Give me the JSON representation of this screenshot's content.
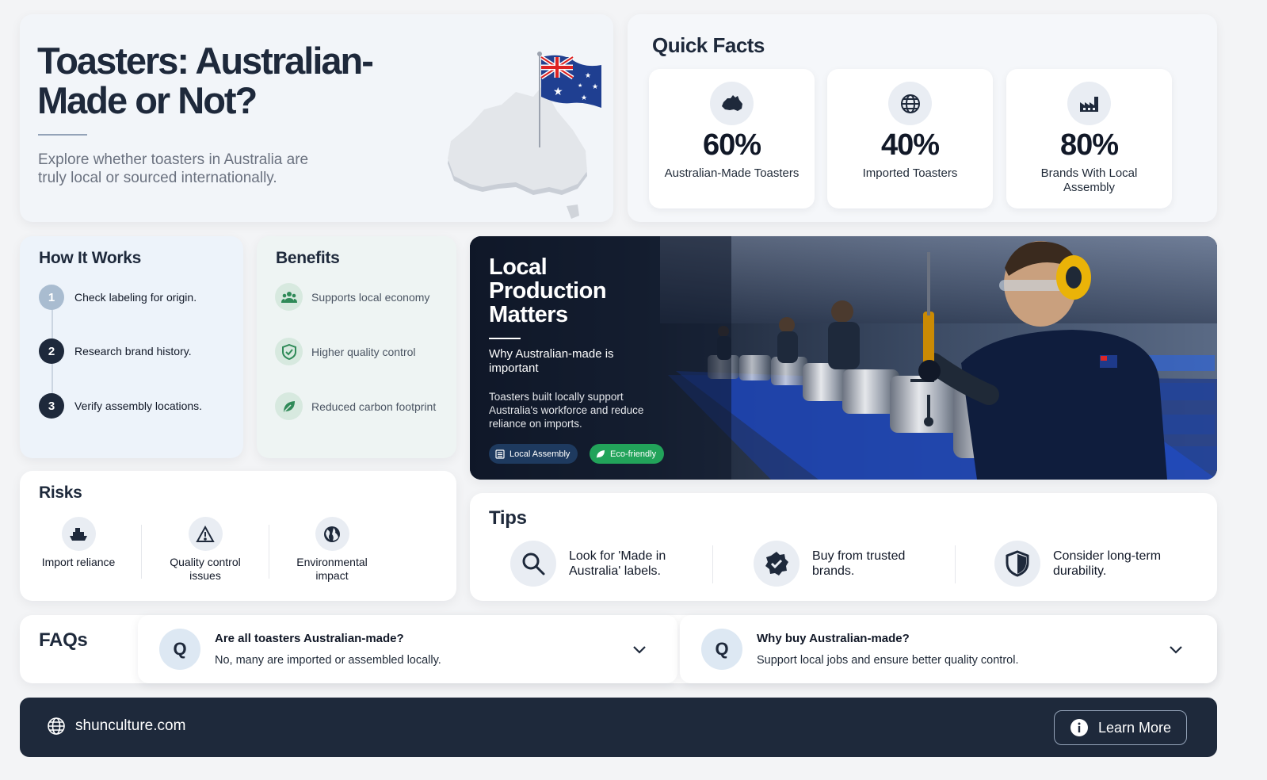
{
  "hero": {
    "title": "Toasters: Australian-Made or Not?",
    "subtitle": "Explore whether toasters in Australia are truly local or sourced internationally."
  },
  "quick_facts": {
    "title": "Quick Facts",
    "items": [
      {
        "icon": "australia-icon",
        "value": "60%",
        "label": "Australian-Made Toasters"
      },
      {
        "icon": "globe-icon",
        "value": "40%",
        "label": "Imported Toasters"
      },
      {
        "icon": "factory-icon",
        "value": "80%",
        "label": "Brands With Local Assembly"
      }
    ]
  },
  "how_it_works": {
    "title": "How It Works",
    "steps": [
      {
        "num": "1",
        "text": "Check labeling for origin."
      },
      {
        "num": "2",
        "text": "Research brand history."
      },
      {
        "num": "3",
        "text": "Verify assembly locations."
      }
    ]
  },
  "benefits": {
    "title": "Benefits",
    "items": [
      {
        "icon": "people-icon",
        "text": "Supports local economy"
      },
      {
        "icon": "shield-check-icon",
        "text": "Higher quality control"
      },
      {
        "icon": "leaf-icon",
        "text": "Reduced carbon footprint"
      }
    ]
  },
  "local_production": {
    "title": "Local Production Matters",
    "subtitle": "Why Australian-made is important",
    "description": "Toasters built locally support Australia's workforce and reduce reliance on imports.",
    "tags": [
      {
        "icon": "factory-icon",
        "label": "Local Assembly",
        "color": "#1e3a5f"
      },
      {
        "icon": "leaf-icon",
        "label": "Eco-friendly",
        "color": "#22a35a"
      }
    ]
  },
  "risks": {
    "title": "Risks",
    "items": [
      {
        "icon": "ship-icon",
        "text": "Import reliance"
      },
      {
        "icon": "warning-icon",
        "text": "Quality control issues"
      },
      {
        "icon": "earth-icon",
        "text": "Environmental impact"
      }
    ]
  },
  "tips": {
    "title": "Tips",
    "items": [
      {
        "icon": "search-icon",
        "text": "Look for 'Made in Australia' labels."
      },
      {
        "icon": "verified-badge-icon",
        "text": "Buy from trusted brands."
      },
      {
        "icon": "shield-icon",
        "text": "Consider long-term durability."
      }
    ]
  },
  "faqs": {
    "title": "FAQs",
    "items": [
      {
        "q_mark": "Q",
        "question": "Are all toasters Australian-made?",
        "answer": "No, many are imported or assembled locally."
      },
      {
        "q_mark": "Q",
        "question": "Why buy Australian-made?",
        "answer": "Support local jobs and ensure better quality control."
      }
    ]
  },
  "footer": {
    "site": "shunculture.com",
    "button": "Learn More"
  }
}
